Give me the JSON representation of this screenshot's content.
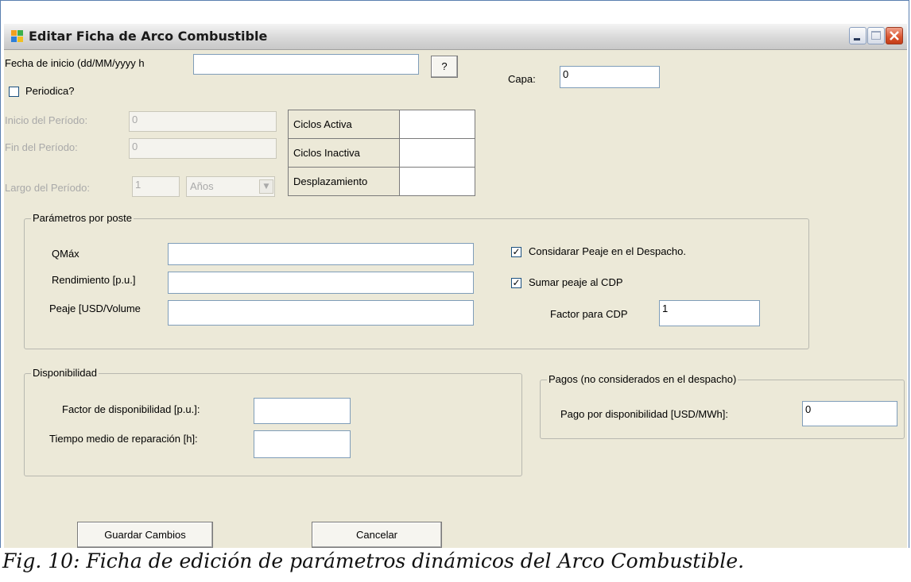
{
  "window": {
    "title": "Editar Ficha de Arco Combustible",
    "accent": "#5a7fb0"
  },
  "header": {
    "fecha_label": "Fecha de inicio (dd/MM/yyyy h",
    "fecha_value": "",
    "help_label": "?",
    "capa_label": "Capa:",
    "capa_value": "0",
    "periodica_label": "Periodica?",
    "periodica_checked": false
  },
  "periodo": {
    "inicio_label": "Inicio del Período:",
    "inicio_value": "0",
    "fin_label": "Fin del Período:",
    "fin_value": "0",
    "largo_label": "Largo del Período:",
    "largo_value": "1",
    "unidad_value": "Años"
  },
  "ciclos": [
    {
      "label": "Ciclos Activa",
      "value": ""
    },
    {
      "label": "Ciclos Inactiva",
      "value": ""
    },
    {
      "label": "Desplazamiento",
      "value": ""
    }
  ],
  "parametros": {
    "title": "Parámetros por poste",
    "qmax_label": "QMáx",
    "qmax_value": "",
    "rendimiento_label": "Rendimiento [p.u.]",
    "rendimiento_value": "",
    "peaje_label": "Peaje [USD/Volume",
    "peaje_value": "",
    "considerar_label": "Considarar Peaje en el Despacho.",
    "considerar_checked": true,
    "sumar_label": "Sumar peaje al CDP",
    "sumar_checked": true,
    "factor_label": "Factor para CDP",
    "factor_value": "1"
  },
  "disponibilidad": {
    "title": "Disponibilidad",
    "factor_label": "Factor de disponibilidad [p.u.]:",
    "factor_value": "",
    "tiempo_label": "Tiempo medio de reparación [h]:",
    "tiempo_value": ""
  },
  "pagos": {
    "title": "Pagos (no considerados en el despacho)",
    "pago_label": "Pago por disponibilidad [USD/MWh]:",
    "pago_value": "0"
  },
  "buttons": {
    "guardar": "Guardar Cambios",
    "cancelar": "Cancelar"
  },
  "caption": "Fig. 10: Ficha de edición de parámetros dinámicos del Arco Combustible."
}
